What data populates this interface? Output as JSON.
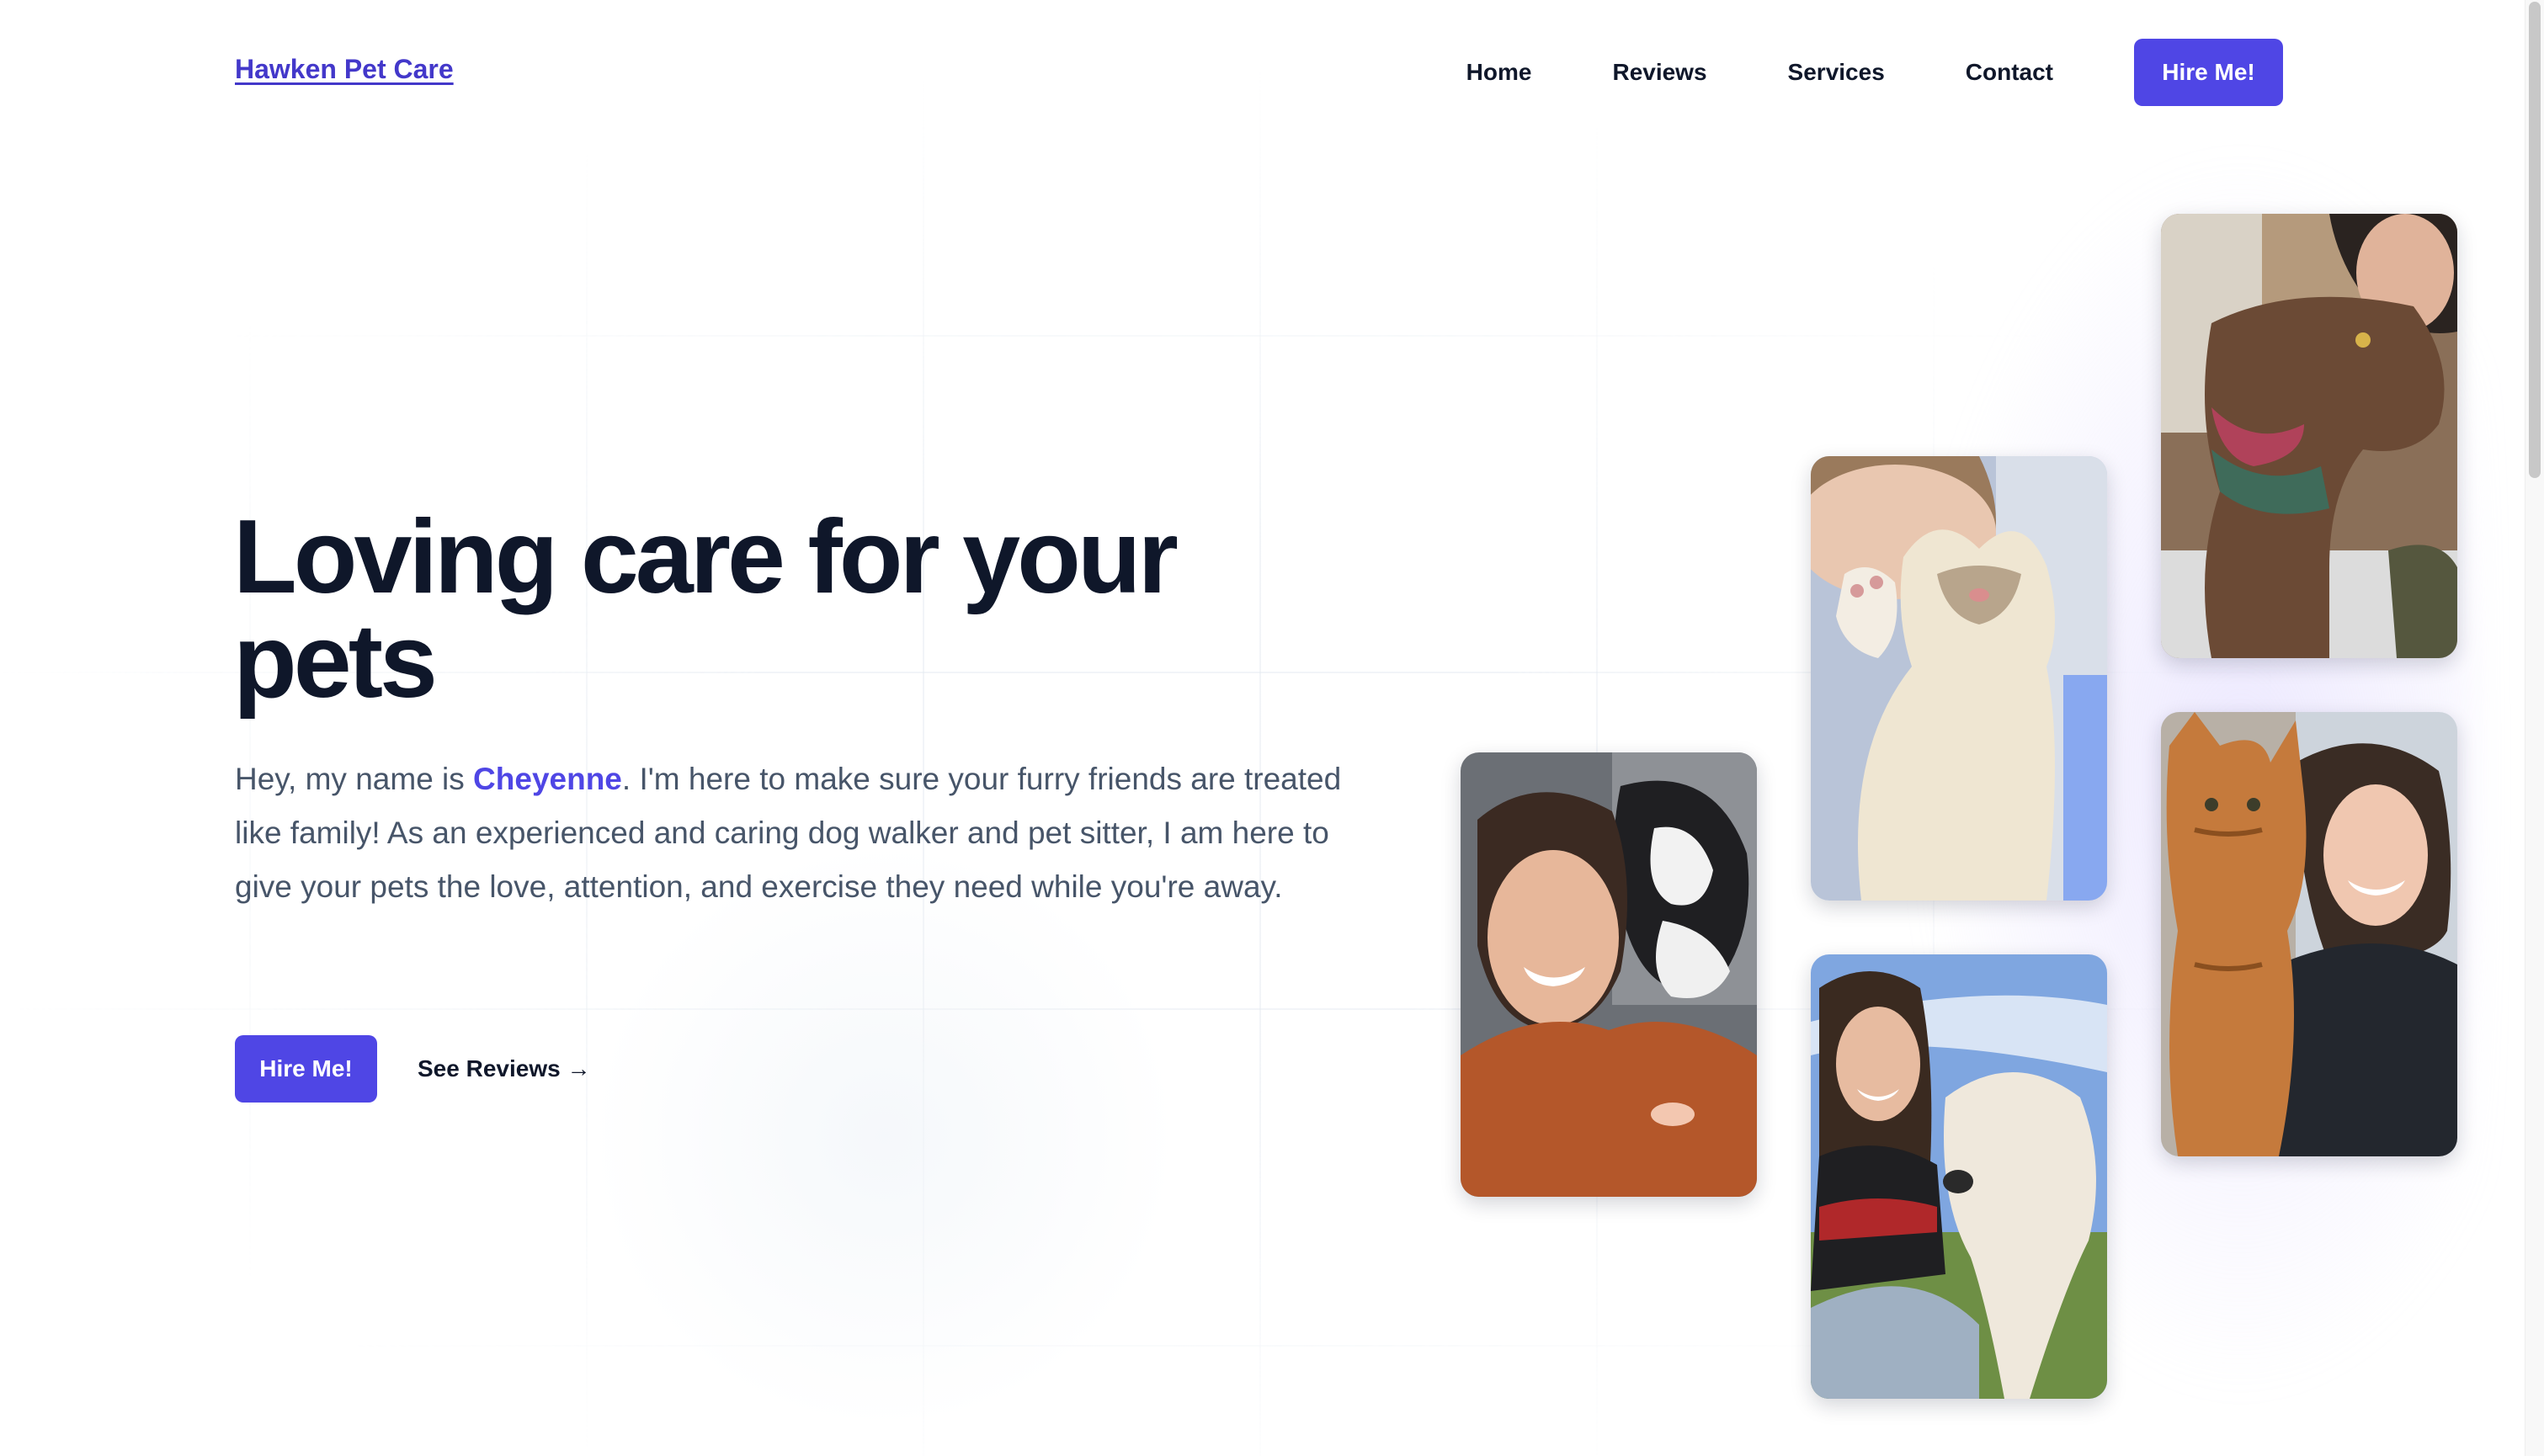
{
  "header": {
    "logo": "Hawken Pet Care",
    "nav": [
      {
        "label": "Home"
      },
      {
        "label": "Reviews"
      },
      {
        "label": "Services"
      },
      {
        "label": "Contact"
      }
    ],
    "cta_label": "Hire Me!"
  },
  "hero": {
    "headline": "Loving care for your pets",
    "intro_prefix": "Hey, my name is ",
    "intro_name": "Cheyenne",
    "intro_suffix": ". I'm here to make sure your furry friends are treated like family! As an experienced and caring dog walker and pet sitter, I am here to give your pets the love, attention, and exercise they need while you're away.",
    "primary_button": "Hire Me!",
    "secondary_link": "See Reviews →"
  },
  "photos": [
    {
      "icon": "photo-woman-with-black-white-cat"
    },
    {
      "icon": "photo-selfie-with-cat-paw"
    },
    {
      "icon": "photo-woman-with-white-dog"
    },
    {
      "icon": "photo-woman-with-brown-pitbull"
    },
    {
      "icon": "photo-woman-with-orange-tabby-cat"
    }
  ],
  "colors": {
    "accent": "#4f46e5",
    "logo": "#4338ca",
    "heading": "#0f172a",
    "body_text": "#475569"
  }
}
